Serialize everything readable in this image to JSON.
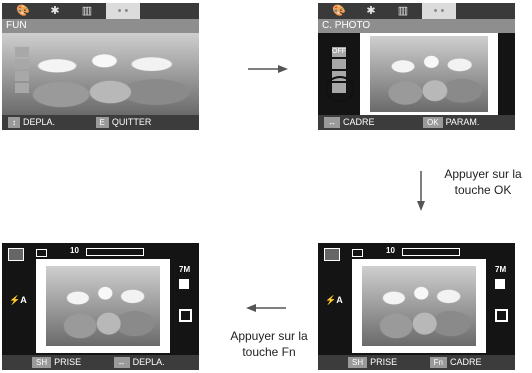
{
  "screen1": {
    "mode": "FUN",
    "tabs": [
      "🎨",
      "✱",
      "▥",
      "• •"
    ],
    "bottom": {
      "key1": "↕",
      "label1": "DEPLA.",
      "key2": "E",
      "label2": "QUITTER"
    }
  },
  "screen2": {
    "mode": "C. PHOTO",
    "tabs": [
      "🎨",
      "✱",
      "▥",
      "• •"
    ],
    "off": "OFF",
    "bottom": {
      "key1": "↔",
      "label1": "CADRE",
      "key2": "OK",
      "label2": "PARAM."
    }
  },
  "screen3": {
    "count": "10",
    "size": "7M",
    "bottom": {
      "key1": "SH",
      "label1": "PRISE",
      "key2": "↔",
      "label2": "DEPLA."
    }
  },
  "screen4": {
    "count": "10",
    "size": "7M",
    "bottom": {
      "key1": "SH",
      "label1": "PRISE",
      "key2": "Fn",
      "label2": "CADRE"
    }
  },
  "captions": {
    "ok_line1": "Appuyer sur la",
    "ok_line2": "touche OK",
    "fn_line1": "Appuyer sur la",
    "fn_line2": "touche Fn"
  }
}
